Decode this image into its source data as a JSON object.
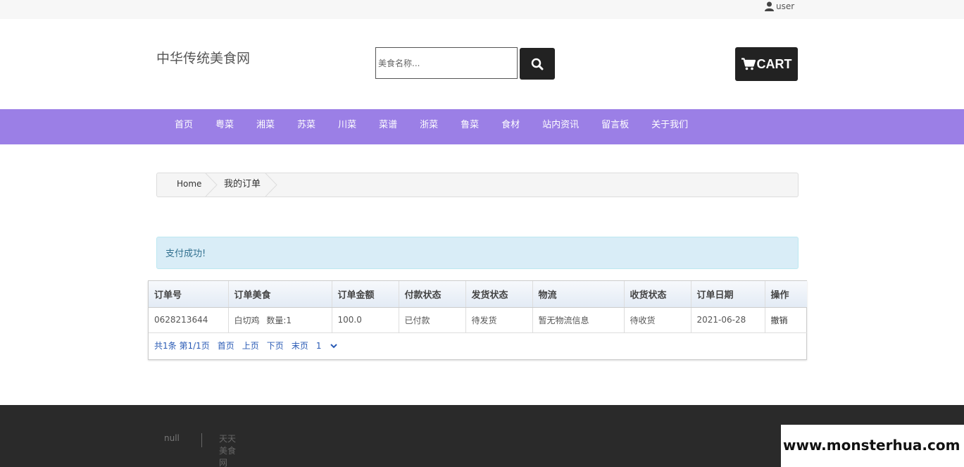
{
  "topbar": {
    "user_label": "user",
    "user_icon": "user-icon"
  },
  "header": {
    "site_title": "中华传统美食网",
    "search": {
      "placeholder": "美食名称...",
      "value": "",
      "icon": "search-icon"
    },
    "cart": {
      "label": "CART",
      "icon": "cart-icon"
    }
  },
  "nav": {
    "items": [
      {
        "label": "首页"
      },
      {
        "label": "粤菜"
      },
      {
        "label": "湘菜"
      },
      {
        "label": "苏菜"
      },
      {
        "label": "川菜"
      },
      {
        "label": "菜谱"
      },
      {
        "label": "浙菜"
      },
      {
        "label": "鲁菜"
      },
      {
        "label": "食材"
      },
      {
        "label": "站内资讯"
      },
      {
        "label": "留言板"
      },
      {
        "label": "关于我们"
      }
    ],
    "bg_color": "#9b7fe6"
  },
  "breadcrumb": {
    "home": "Home",
    "current": "我的订单"
  },
  "alert": {
    "message": "支付成功!",
    "color": "#d9edf7"
  },
  "orders": {
    "columns": [
      "订单号",
      "订单美食",
      "订单金额",
      "付款状态",
      "发货状态",
      "物流",
      "收货状态",
      "订单日期",
      "操作"
    ],
    "rows": [
      {
        "order_no": "0628213644",
        "food": "白切鸡",
        "qty_label": "数量:",
        "qty": "1",
        "amount": "100.0",
        "pay_status": "已付款",
        "ship_status": "待发货",
        "logistics": "暂无物流信息",
        "receive_status": "待收货",
        "date": "2021-06-28",
        "action": "撤销"
      }
    ]
  },
  "pagination": {
    "info": "共1条 第1/1页",
    "first": "首页",
    "prev": "上页",
    "next": "下页",
    "last": "末页",
    "page_select": "1",
    "select_icon": "chevron-down-icon"
  },
  "footer": {
    "left_text": "null",
    "right_text": "天天美食网"
  },
  "watermark": {
    "text": "www.monsterhua.com"
  }
}
